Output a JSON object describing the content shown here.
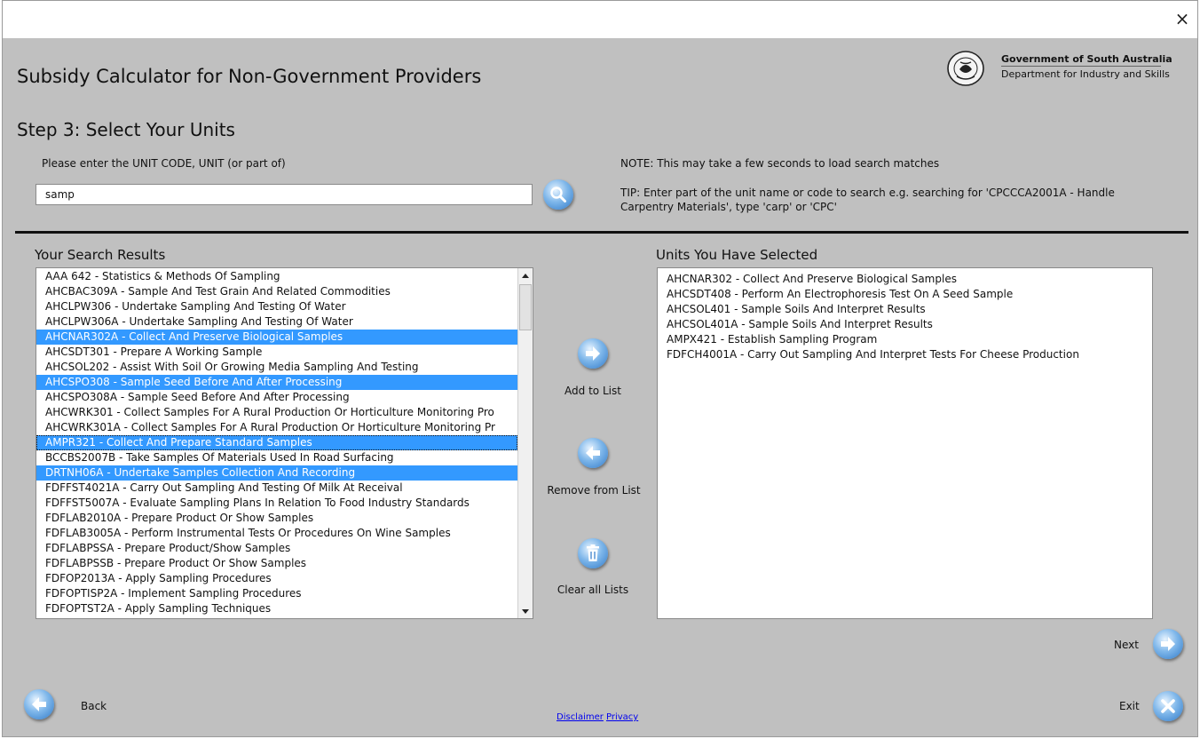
{
  "window": {
    "close_glyph": "×"
  },
  "header": {
    "app_title": "Subsidy Calculator for Non-Government Providers",
    "step_title": "Step 3: Select Your Units",
    "logo": {
      "seal_text": "SOUTH AUSTRALIA",
      "line1": "Government of South Australia",
      "line2": "Department for Industry and Skills"
    }
  },
  "search": {
    "prompt": "Please enter the UNIT CODE, UNIT (or part of)",
    "value": "samp",
    "button_icon": "search-icon",
    "note": "NOTE: This may take a few seconds to load search matches",
    "tip": "TIP: Enter part of the unit name or code to search e.g. searching for 'CPCCCA2001A - Handle Carpentry Materials', type 'carp' or 'CPC'"
  },
  "results": {
    "header": "Your Search Results",
    "items": [
      {
        "text": "AAA 642  -  Statistics & Methods Of Sampling",
        "selected": false
      },
      {
        "text": "AHCBAC309A  -  Sample And Test Grain And Related Commodities",
        "selected": false
      },
      {
        "text": "AHCLPW306  -  Undertake Sampling And Testing Of Water",
        "selected": false
      },
      {
        "text": "AHCLPW306A  -  Undertake Sampling And Testing Of Water",
        "selected": false
      },
      {
        "text": "AHCNAR302A  -  Collect And Preserve Biological Samples",
        "selected": true
      },
      {
        "text": "AHCSDT301  -  Prepare A Working Sample",
        "selected": false
      },
      {
        "text": "AHCSOL202  -  Assist With Soil Or Growing Media Sampling And Testing",
        "selected": false
      },
      {
        "text": "AHCSPO308  -  Sample Seed Before And After Processing",
        "selected": true
      },
      {
        "text": "AHCSPO308A  -  Sample Seed Before And After Processing",
        "selected": false
      },
      {
        "text": "AHCWRK301  -  Collect Samples For A Rural Production Or Horticulture Monitoring Pro",
        "selected": false
      },
      {
        "text": "AHCWRK301A  -  Collect Samples For A Rural Production Or Horticulture Monitoring Pr",
        "selected": false
      },
      {
        "text": "AMPR321  -  Collect And Prepare Standard Samples",
        "selected": true,
        "focus": true
      },
      {
        "text": "BCCBS2007B  -  Take Samples Of Materials Used In Road Surfacing",
        "selected": false
      },
      {
        "text": "DRTNH06A  -  Undertake Samples Collection And Recording",
        "selected": true
      },
      {
        "text": "FDFFST4021A  -  Carry Out Sampling And Testing Of Milk At Receival",
        "selected": false
      },
      {
        "text": "FDFFST5007A  -  Evaluate Sampling Plans In Relation To Food Industry Standards",
        "selected": false
      },
      {
        "text": "FDFLAB2010A  -  Prepare Product Or Show Samples",
        "selected": false
      },
      {
        "text": "FDFLAB3005A  -  Perform Instrumental Tests Or Procedures On Wine Samples",
        "selected": false
      },
      {
        "text": "FDFLABPSSA  -  Prepare Product/Show Samples",
        "selected": false
      },
      {
        "text": "FDFLABPSSB  -  Prepare Product Or Show Samples",
        "selected": false
      },
      {
        "text": "FDFOP2013A  -  Apply Sampling Procedures",
        "selected": false
      },
      {
        "text": "FDFOPTISP2A  -  Implement Sampling Procedures",
        "selected": false
      },
      {
        "text": "FDFOPTST2A  -  Apply Sampling Techniques",
        "selected": false
      }
    ]
  },
  "selected_units": {
    "header": "Units You Have Selected",
    "items": [
      "AHCNAR302  -  Collect And Preserve Biological Samples",
      "AHCSDT408  -  Perform An Electrophoresis Test On A Seed Sample",
      "AHCSOL401  -  Sample Soils And Interpret Results",
      "AHCSOL401A  -  Sample Soils And Interpret Results",
      "AMPX421  -  Establish Sampling Program",
      "FDFCH4001A  -  Carry Out Sampling And Interpret Tests For Cheese Production"
    ]
  },
  "actions": {
    "add": {
      "label": "Add to List",
      "icon": "arrow-right-icon"
    },
    "remove": {
      "label": "Remove from List",
      "icon": "arrow-left-icon"
    },
    "clear": {
      "label": "Clear all Lists",
      "icon": "trash-icon"
    }
  },
  "navigation": {
    "next": {
      "label": "Next",
      "icon": "arrow-right-icon"
    },
    "back": {
      "label": "Back",
      "icon": "arrow-left-icon"
    },
    "exit": {
      "label": "Exit",
      "icon": "close-icon"
    }
  },
  "footer": {
    "disclaimer": "Disclaimer",
    "privacy": "Privacy"
  },
  "colors": {
    "background": "#c0c0c0",
    "selection": "#3399ff",
    "button_blue": "#2f79c8"
  }
}
